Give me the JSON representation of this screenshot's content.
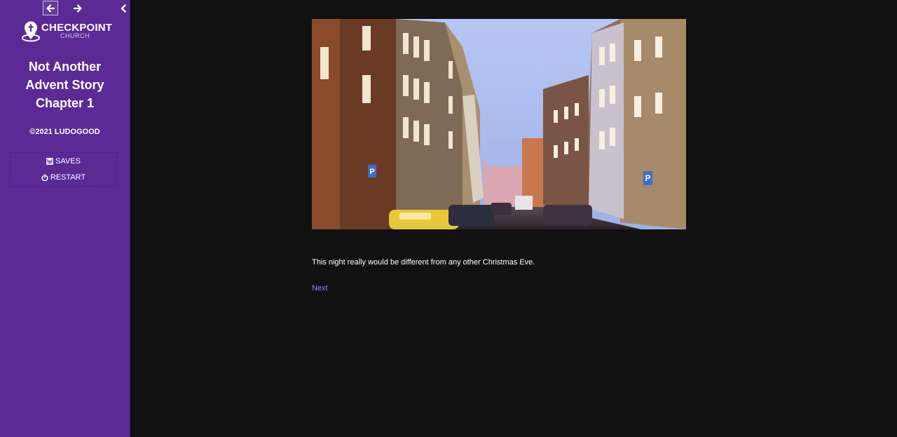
{
  "sidebar": {
    "nav": {
      "back_icon": "arrow-left-icon",
      "forward_icon": "arrow-right-icon",
      "collapse_icon": "chevron-left-icon"
    },
    "logo": {
      "icon": "map-pin-cross-icon",
      "name": "CHECKPOINT",
      "subname": "CHURCH"
    },
    "title_lines": [
      "Not Another",
      "Advent Story",
      "Chapter 1"
    ],
    "copyright": "©2021 LUDOGOOD",
    "menu": [
      {
        "icon": "floppy-disk-icon",
        "label": "SAVES"
      },
      {
        "icon": "power-icon",
        "label": "RESTART"
      }
    ]
  },
  "main": {
    "image_description_icon": "city-street-scene",
    "passage": "This night really would be different from any other Christmas Eve.",
    "next_label": "Next"
  },
  "colors": {
    "sidebar_bg": "#5b2a95",
    "page_bg": "#111111",
    "link": "#7b8fe0"
  }
}
